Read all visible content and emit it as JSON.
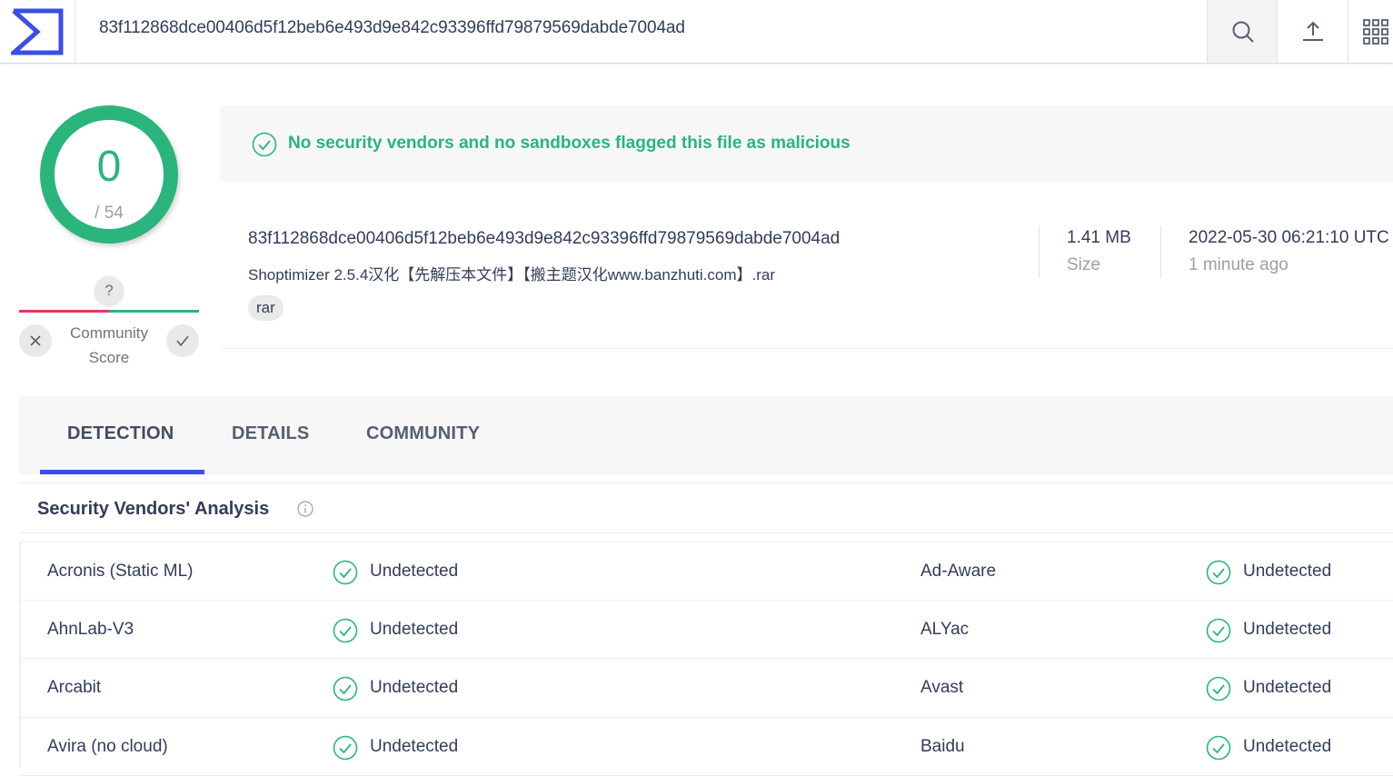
{
  "search": {
    "query": "83f112868dce00406d5f12beb6e493d9e842c93396ffd79879569dabde7004ad"
  },
  "score": {
    "detections": "0",
    "total": "/ 54"
  },
  "community": {
    "question": "?",
    "label_line1": "Community",
    "label_line2": "Score"
  },
  "banner": {
    "text": "No security vendors and no sandboxes flagged this file as malicious"
  },
  "file": {
    "hash": "83f112868dce00406d5f12beb6e493d9e842c93396ffd79879569dabde7004ad",
    "name": "Shoptimizer 2.5.4汉化【先解压本文件】【搬主题汉化www.banzhuti.com】.rar",
    "tag": "rar",
    "size": "1.41 MB",
    "size_label": "Size",
    "date": "2022-05-30 06:21:10 UTC",
    "ago": "1 minute ago"
  },
  "tabs": [
    {
      "label": "DETECTION"
    },
    {
      "label": "DETAILS"
    },
    {
      "label": "COMMUNITY"
    }
  ],
  "section": {
    "title": "Security Vendors' Analysis"
  },
  "vendors": [
    {
      "left": "Acronis (Static ML)",
      "left_result": "Undetected",
      "right": "Ad-Aware",
      "right_result": "Undetected"
    },
    {
      "left": "AhnLab-V3",
      "left_result": "Undetected",
      "right": "ALYac",
      "right_result": "Undetected"
    },
    {
      "left": "Arcabit",
      "left_result": "Undetected",
      "right": "Avast",
      "right_result": "Undetected"
    },
    {
      "left": "Avira (no cloud)",
      "left_result": "Undetected",
      "right": "Baidu",
      "right_result": "Undetected"
    }
  ],
  "colors": {
    "clean": "#2ab57d",
    "malicious": "#e8365d",
    "accent": "#3b4ee6"
  }
}
